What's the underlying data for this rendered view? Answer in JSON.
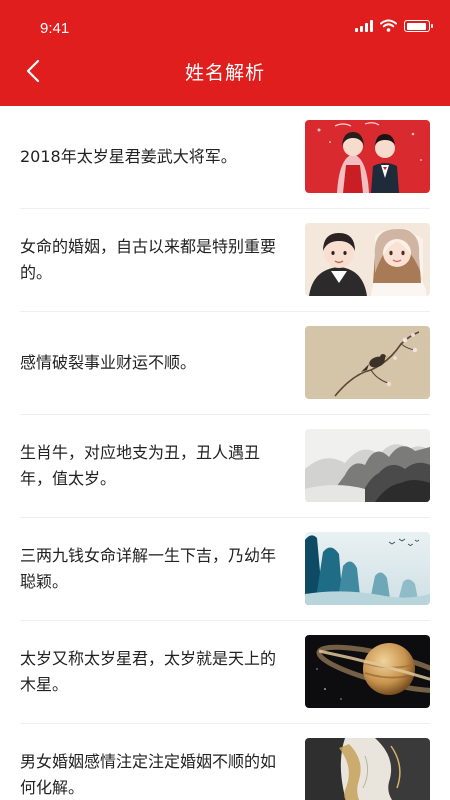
{
  "status_bar": {
    "time": "9:41"
  },
  "header": {
    "title": "姓名解析",
    "back_icon": "chevron-left-icon"
  },
  "articles": [
    {
      "text": "2018年太岁星君姜武大将军。",
      "thumbnail": "wedding-couple-image"
    },
    {
      "text": "女命的婚姻，自古以来都是特别重要的。",
      "thumbnail": "cartoon-couple-image"
    },
    {
      "text": "感情破裂事业财运不顺。",
      "thumbnail": "bird-on-branch-painting"
    },
    {
      "text": "生肖牛，对应地支为丑，丑人遇丑年，值太岁。",
      "thumbnail": "ink-mountain-painting"
    },
    {
      "text": "三两九钱女命详解一生下吉，乃幼年聪颖。",
      "thumbnail": "blue-landscape-painting"
    },
    {
      "text": "太岁又称太岁星君，太岁就是天上的木星。",
      "thumbnail": "saturn-planet-image"
    },
    {
      "text": "男女婚姻感情注定注定婚姻不顺的如何化解。",
      "thumbnail": "abstract-ink-art"
    }
  ],
  "colors": {
    "header_bg": "#e01e1e",
    "text": "#222222",
    "divider": "#eeeeee"
  }
}
